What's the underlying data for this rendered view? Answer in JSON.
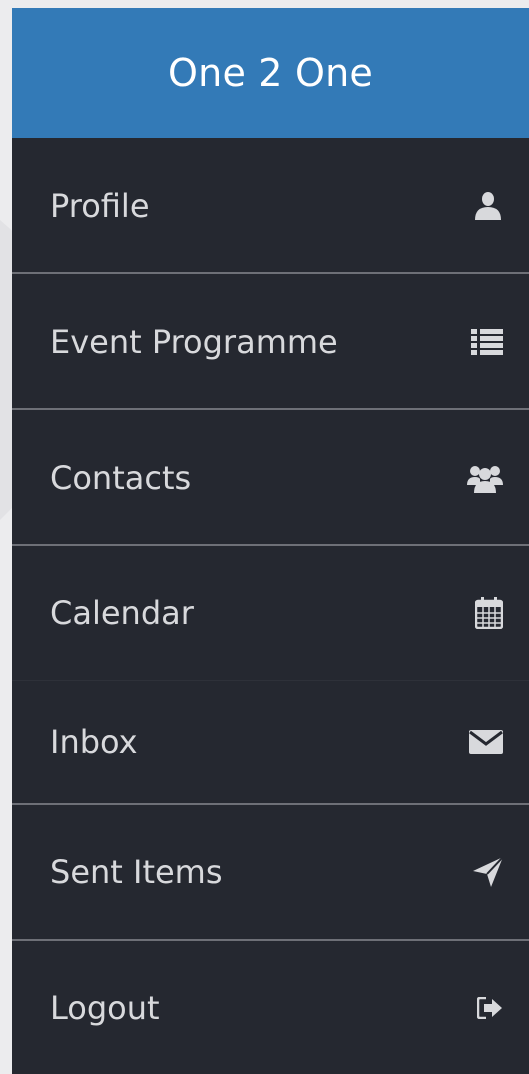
{
  "header": {
    "title": "One 2 One"
  },
  "menu": {
    "items": [
      {
        "label": "Profile",
        "icon": "user-icon"
      },
      {
        "label": "Event Programme",
        "icon": "list-icon"
      },
      {
        "label": "Contacts",
        "icon": "users-icon"
      },
      {
        "label": "Calendar",
        "icon": "calendar-icon"
      },
      {
        "label": "Inbox",
        "icon": "envelope-icon"
      },
      {
        "label": "Sent Items",
        "icon": "paper-plane-icon"
      },
      {
        "label": "Logout",
        "icon": "sign-out-icon"
      }
    ]
  },
  "colors": {
    "header_bg": "#337ab7",
    "menu_bg": "#252830",
    "text": "#d8d9dc",
    "divider": "#6e7077"
  }
}
